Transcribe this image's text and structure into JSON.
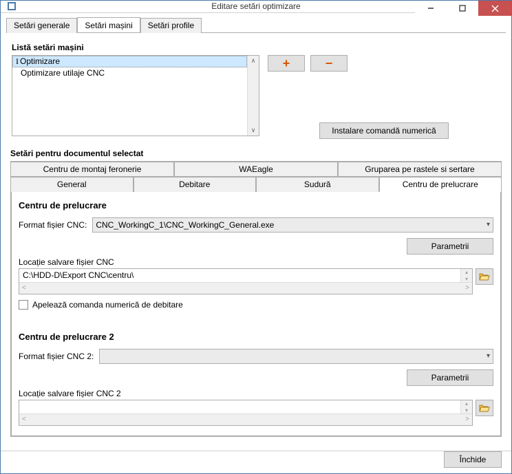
{
  "window": {
    "title": "Editare setări optimizare"
  },
  "tabs": {
    "general": "Setări generale",
    "machines": "Setări mașini",
    "profiles": "Setări profile"
  },
  "list": {
    "title": "Listă setări mașini",
    "items": [
      {
        "label": "Optimizare"
      },
      {
        "label": "Optimizare utilaje CNC"
      }
    ]
  },
  "buttons": {
    "install": "Instalare comandă numerică",
    "close": "Închide",
    "params": "Parametrii"
  },
  "docsection": {
    "title": "Setări pentru documentul selectat"
  },
  "tabs2": {
    "row1": {
      "fittings": "Centru de montaj feronerie",
      "waeagle": "WAEagle",
      "grouping": "Gruparea pe rastele si sertare"
    },
    "row2": {
      "general": "General",
      "cutting": "Debitare",
      "welding": "Sudură",
      "workcenter": "Centru de prelucrare"
    }
  },
  "wc1": {
    "title": "Centru de prelucrare",
    "format_label": "Format fișier CNC:",
    "format_value": "CNC_WorkingC_1\\CNC_WorkingC_General.exe",
    "loc_label": "Locație salvare fișier CNC",
    "loc_value": "C:\\HDD-D\\Export CNC\\centru\\",
    "call_label": "Apelează comanda numerică de debitare"
  },
  "wc2": {
    "title": "Centru de prelucrare 2",
    "format_label": "Format fișier CNC 2:",
    "format_value": "",
    "loc_label": "Locație salvare fișier CNC 2",
    "loc_value": ""
  }
}
